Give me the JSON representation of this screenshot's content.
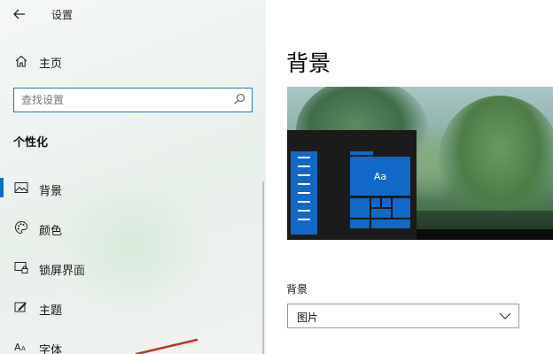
{
  "window": {
    "title": "设置"
  },
  "sidebar": {
    "home_label": "主页",
    "search_placeholder": "查找设置",
    "section_title": "个性化",
    "items": [
      {
        "label": "背景",
        "icon": "image-icon",
        "active": true
      },
      {
        "label": "颜色",
        "icon": "palette-icon",
        "active": false
      },
      {
        "label": "锁屏界面",
        "icon": "lock-screen-icon",
        "active": false
      },
      {
        "label": "主题",
        "icon": "theme-icon",
        "active": false
      },
      {
        "label": "字体",
        "icon": "font-icon",
        "active": false
      }
    ]
  },
  "main": {
    "page_title": "背景",
    "preview": {
      "tile_text": "Aa"
    },
    "background_label": "背景",
    "background_value": "图片"
  },
  "colors": {
    "accent": "#0a6fc2",
    "tile_blue": "#1168c7",
    "annotation_red": "#c0342b"
  }
}
